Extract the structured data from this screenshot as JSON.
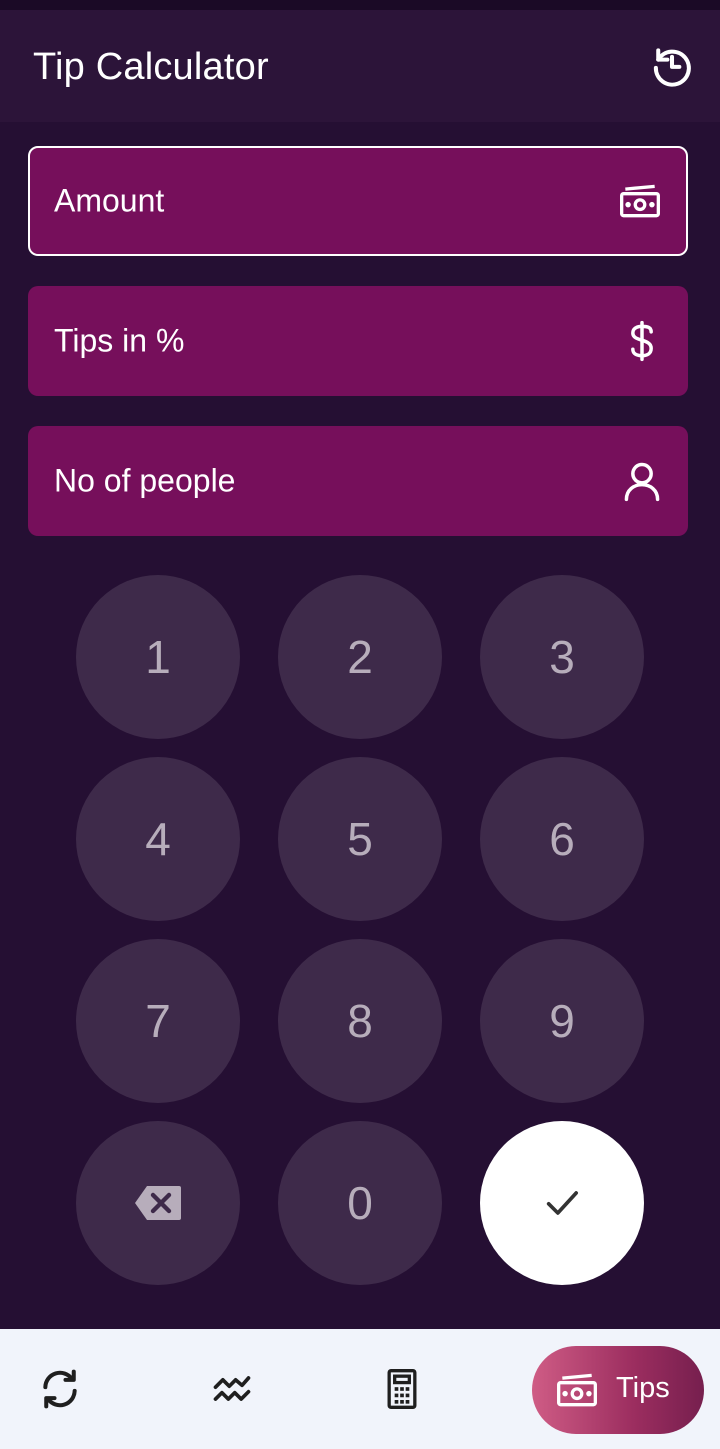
{
  "app": {
    "title": "Tip Calculator"
  },
  "icons": {
    "history": "history-icon",
    "amount": "cash-icon",
    "tips": "dollar-icon",
    "people": "person-icon",
    "backspace": "backspace-icon",
    "confirm": "check-icon",
    "nav_convert": "sync-icon",
    "nav_stats": "chart-icon",
    "nav_calculator": "calculator-icon",
    "nav_tips": "cash-icon"
  },
  "fields": {
    "amount": {
      "label": "Amount"
    },
    "tips": {
      "label": "Tips in %"
    },
    "people": {
      "label": "No of people"
    }
  },
  "keypad": {
    "k1": "1",
    "k2": "2",
    "k3": "3",
    "k4": "4",
    "k5": "5",
    "k6": "6",
    "k7": "7",
    "k8": "8",
    "k9": "9",
    "k0": "0"
  },
  "bottom_nav": {
    "tips_label": "Tips"
  },
  "colors": {
    "background": "#250f33",
    "appbar": "#2c1439",
    "field": "#760f5b",
    "key": "#3e2a4a",
    "key_text": "#b7adbb",
    "bottom_bar": "#f1f4fb",
    "accent_pill": "#b23f6e"
  }
}
